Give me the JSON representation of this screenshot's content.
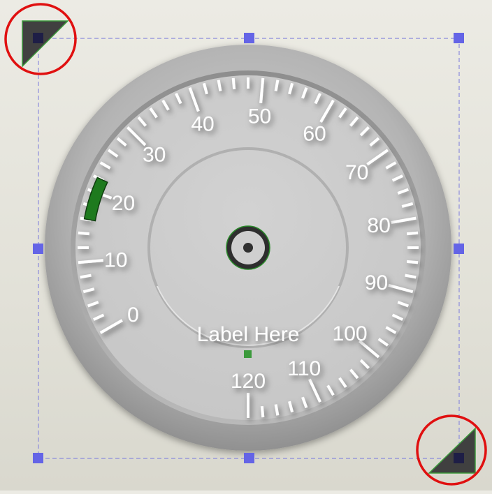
{
  "gauge": {
    "scale_labels": [
      "0",
      "10",
      "20",
      "30",
      "40",
      "50",
      "60",
      "70",
      "80",
      "90",
      "100",
      "110",
      "120"
    ],
    "min": 0,
    "max": 120,
    "center_label": "Label Here",
    "range_indicator": {
      "from": 16,
      "to": 22,
      "color": "#1e7a1e"
    }
  },
  "colors": {
    "selection_handle": "#6464e6",
    "selection_box": "#8c8cdc",
    "highlight_circle": "#e01010",
    "resize_grip": "#404040",
    "hub_accent": "#2a8a2a"
  }
}
